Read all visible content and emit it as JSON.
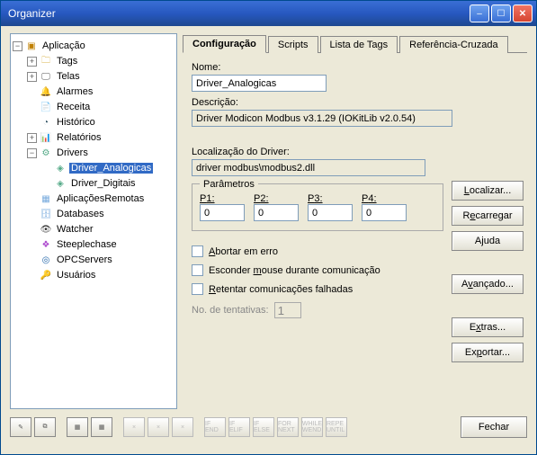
{
  "window": {
    "title": "Organizer"
  },
  "tree": {
    "root": "Aplicação",
    "nodes": {
      "tags": "Tags",
      "telas": "Telas",
      "alarmes": "Alarmes",
      "receita": "Receita",
      "historico": "Histórico",
      "relatorios": "Relatórios",
      "drivers": "Drivers",
      "driver_analog": "Driver_Analogicas",
      "driver_digit": "Driver_Digitais",
      "app_remotas": "AplicaçõesRemotas",
      "databases": "Databases",
      "watcher": "Watcher",
      "steeplechase": "Steeplechase",
      "opcservers": "OPCServers",
      "usuarios": "Usuários"
    }
  },
  "tabs": {
    "config": "Configuração",
    "scripts": "Scripts",
    "lista_tags": "Lista de Tags",
    "ref_cruzada": "Referência-Cruzada"
  },
  "form": {
    "nome_label": "Nome:",
    "nome_value": "Driver_Analogicas",
    "desc_label": "Descrição:",
    "desc_value": "Driver Modicon Modbus v3.1.29 (IOKitLib v2.0.54)",
    "loc_label": "Localização do Driver:",
    "loc_value": "driver modbus\\modbus2.dll",
    "params_legend": "Parâmetros",
    "p1_label": "P1:",
    "p1_value": "0",
    "p2_label": "P2:",
    "p2_value": "0",
    "p3_label": "P3:",
    "p3_value": "0",
    "p4_label": "P4:",
    "p4_value": "0",
    "chk_abortar": "Abortar em erro",
    "chk_esconder": "Esconder mouse durante comunicação",
    "chk_retentar": "Retentar comunicações falhadas",
    "retries_label": "No. de tentativas:",
    "retries_value": "1"
  },
  "buttons": {
    "localizar": "Localizar...",
    "recarregar": "Recarregar",
    "ajuda": "Ajuda",
    "avancado": "Avançado...",
    "extras": "Extras...",
    "exportar": "Exportar...",
    "fechar": "Fechar"
  },
  "toolbar": {
    "b1": "",
    "b2": "",
    "b3": "",
    "b4": "",
    "b5": "",
    "b6": "",
    "b7": "",
    "b8": "IF END",
    "b9": "IF ELIF",
    "b10": "IF ELSE",
    "b11": "FOR NEXT",
    "b12": "WHILE WEND",
    "b13": "REPE UNTIL"
  }
}
